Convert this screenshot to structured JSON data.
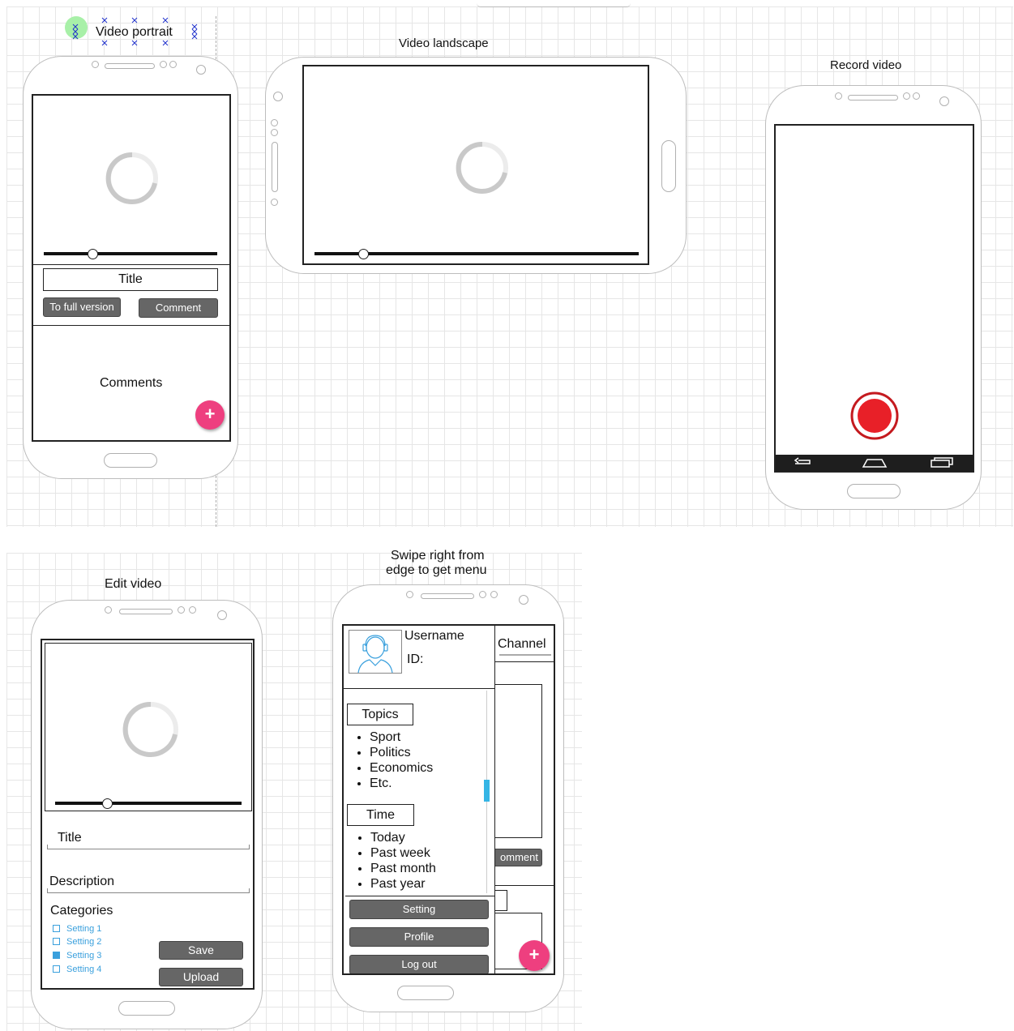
{
  "colors": {
    "fab": "#ee3f7f",
    "record": "#e82028",
    "scrollbar": "#35b5e5",
    "button": "#666666",
    "selection_handle": "#a8f0a8",
    "checkbox": "#3aa0dd"
  },
  "video_portrait": {
    "label": "Video portrait",
    "title_box": "Title",
    "to_full_button": "To full version",
    "comment_button": "Comment",
    "comments_text": "Comments",
    "fab_icon": "+"
  },
  "video_landscape": {
    "label": "Video landscape"
  },
  "record_video": {
    "label": "Record video"
  },
  "edit_video": {
    "label": "Edit video",
    "title_field": "Title",
    "description_field": "Description",
    "categories_label": "Categories",
    "settings": [
      {
        "label": "Setting 1",
        "checked": false
      },
      {
        "label": "Setting 2",
        "checked": false
      },
      {
        "label": "Setting 3",
        "checked": true
      },
      {
        "label": "Setting 4",
        "checked": false
      }
    ],
    "save_button": "Save",
    "upload_button": "Upload"
  },
  "menu_screen": {
    "label_line1": "Swipe right from",
    "label_line2": "edge to get menu",
    "username": "Username",
    "id_label": "ID:",
    "channel_tab": "Channel",
    "topics_header": "Topics",
    "topics": [
      "Sport",
      "Politics",
      "Economics",
      "Etc."
    ],
    "time_header": "Time",
    "times": [
      "Today",
      "Past week",
      "Past month",
      "Past year"
    ],
    "setting_button": "Setting",
    "profile_button": "Profile",
    "logout_button": "Log out",
    "behind_comment_button": "omment",
    "fab_icon": "+"
  }
}
